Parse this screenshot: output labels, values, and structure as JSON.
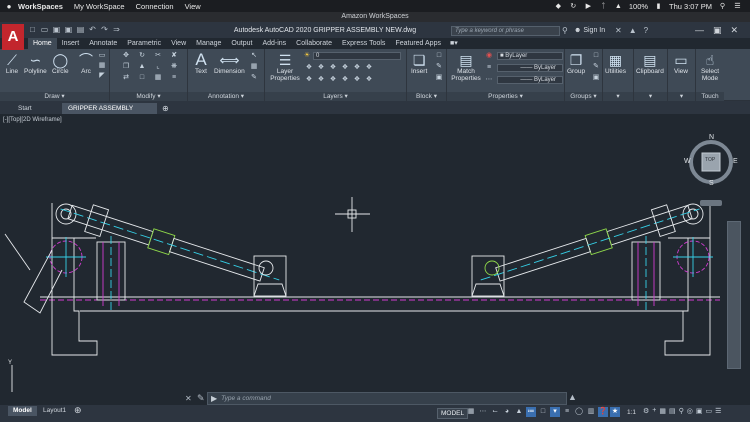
{
  "macbar": {
    "apple": "",
    "menus": [
      "WorkSpaces",
      "My WorkSpace",
      "Connection",
      "View"
    ],
    "battery": "100%",
    "clock": "Thu 3:07 PM"
  },
  "workspace": {
    "title": "Amazon WorkSpaces"
  },
  "acad": {
    "title": "Autodesk AutoCAD 2020   GRIPPER ASSEMBLY NEW.dwg",
    "search_placeholder": "Type a keyword or phrase",
    "signin": "Sign In",
    "logo_letter": "A"
  },
  "ribbon": {
    "tabs": [
      "Home",
      "Insert",
      "Annotate",
      "Parametric",
      "View",
      "Manage",
      "Output",
      "Add-ins",
      "Collaborate",
      "Express Tools",
      "Featured Apps"
    ],
    "active_tab": "Home",
    "draw": {
      "label": "Draw",
      "line": "Line",
      "polyline": "Polyline",
      "circle": "Circle",
      "arc": "Arc"
    },
    "modify": {
      "label": "Modify"
    },
    "annotation": {
      "label": "Annotation",
      "text": "Text",
      "dimension": "Dimension"
    },
    "layers": {
      "label": "Layers",
      "layer_properties": "Layer Properties",
      "layer_value": "0"
    },
    "block": {
      "label": "Block",
      "insert": "Insert"
    },
    "properties": {
      "label": "Properties",
      "match": "Match Properties",
      "color": "ByLayer",
      "linetype": "ByLayer",
      "lineweight": "ByLayer"
    },
    "groups": {
      "label": "Groups",
      "group": "Group"
    },
    "utilities": {
      "label": "Utilities"
    },
    "clipboard": {
      "label": "Clipboard"
    },
    "view": {
      "label": "View"
    },
    "touch": {
      "label": "Touch",
      "select_mode": "Select Mode"
    }
  },
  "filetabs": {
    "start": "Start",
    "active": "GRIPPER ASSEMBLY NEW*"
  },
  "viewport": {
    "label": "[-][Top][2D Wireframe]",
    "compass": {
      "n": "N",
      "s": "S",
      "e": "E",
      "w": "W",
      "top": "TOP"
    }
  },
  "command": {
    "placeholder": "Type a command"
  },
  "status": {
    "layout_tabs": [
      "Model",
      "Layout1"
    ],
    "model_button": "MODEL",
    "scale": "1:1"
  },
  "colors": {
    "background": "#212830",
    "ribbon": "#3f4a56",
    "drawing_white": "#e6e9ec",
    "drawing_cyan": "#35d1e8",
    "drawing_magenta": "#d13cd1",
    "drawing_green": "#8fd84a",
    "logo_red": "#c2262d",
    "accent_blue": "#3a6fb0"
  }
}
